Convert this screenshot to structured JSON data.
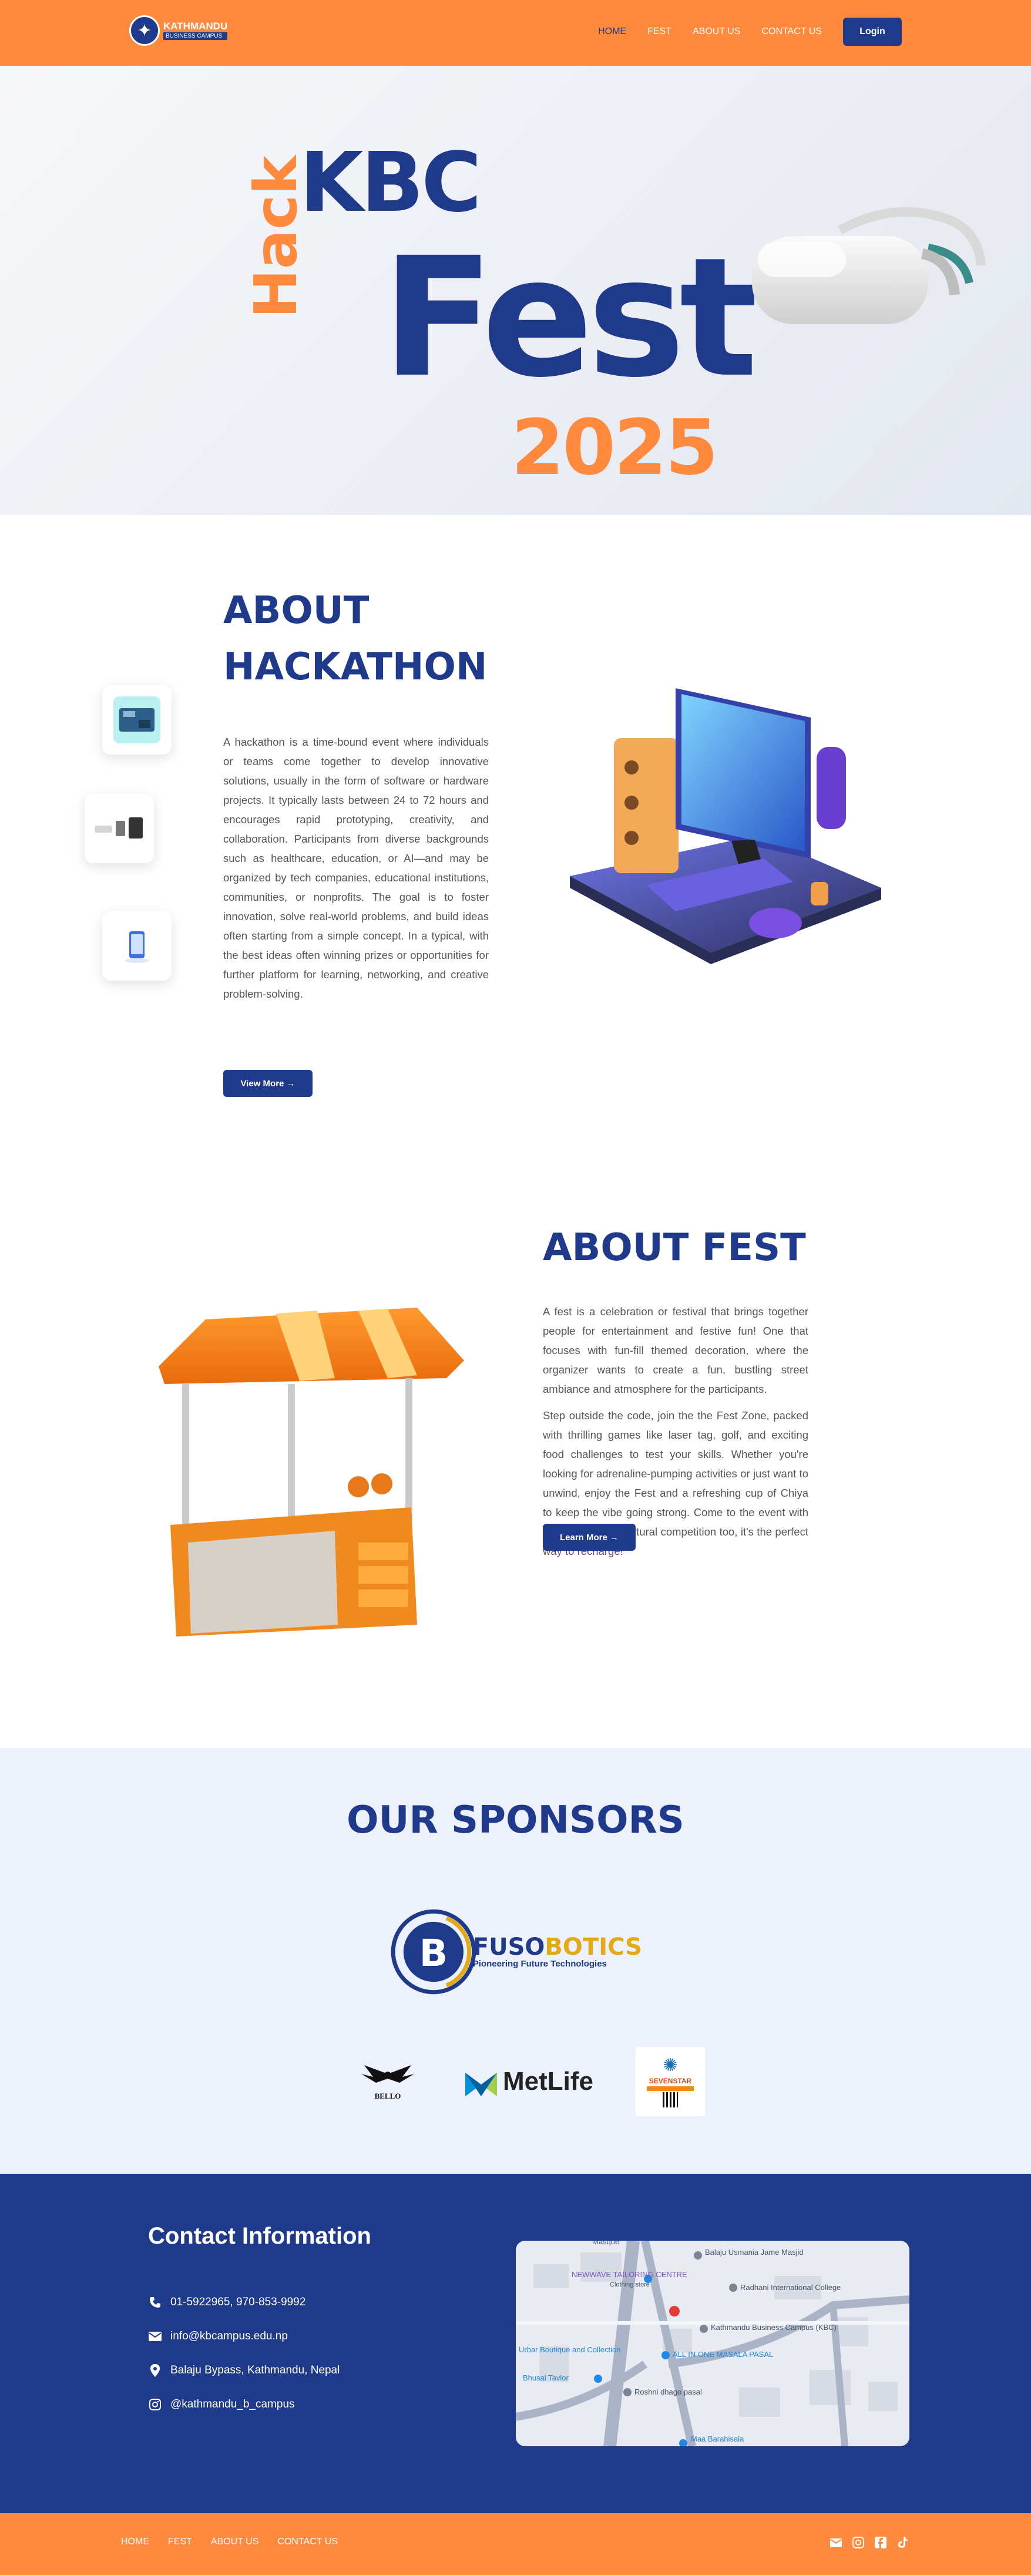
{
  "nav": {
    "logo_line1": "KATHMANDU",
    "logo_line2": "BUSINESS CAMPUS",
    "links": [
      "HOME",
      "FEST",
      "ABOUT US",
      "CONTACT US"
    ],
    "login": "Login"
  },
  "hero": {
    "kbc": "KBC",
    "hack": "Hack",
    "fest": "Fest",
    "year": "2025"
  },
  "about_hackathon": {
    "title": "ABOUT HACKATHON",
    "body": "A hackathon is a time-bound event where individuals or teams come together to develop innovative solutions, usually in the form of software or hardware projects. It typically lasts between 24 to 72 hours and encourages rapid prototyping, creativity, and collaboration. Participants from diverse backgrounds such as healthcare, education, or AI—and may be organized by tech companies, educational institutions, communities, or nonprofits. The goal is to foster innovation, solve real-world problems, and build ideas often starting from a simple concept. In a typical, with the best ideas often winning prizes or opportunities for further platform for learning, networking, and creative problem-solving.",
    "button": "View More →"
  },
  "about_fest": {
    "title": "ABOUT FEST",
    "p1": "A fest is a celebration or festival that brings together people for entertainment and festive fun! One that focuses with fun-fill themed decoration, where the organizer wants to create a fun, bustling street ambiance and atmosphere for the participants.",
    "p2": "Step outside the code, join the the Fest Zone, packed with thrilling games like laser tag, golf, and exciting food challenges to test your skills. Whether you're looking for adrenaline-pumping activities or just want to unwind, enjoy the Fest and a refreshing cup of Chiya to keep the vibe going strong. Come to the event with fun musical and cultural competition too, it's the perfect way to recharge!",
    "button": "Learn More →"
  },
  "sponsors": {
    "title": "OUR SPONSORS",
    "main_name_a": "FUSO",
    "main_name_b": "BOTICS",
    "main_tagline": "Pioneering Future Technologies",
    "bello": "BELLO",
    "metlife": "MetLife",
    "sevenstar": "SEVENSTAR"
  },
  "contact": {
    "title": "Contact Information",
    "phone": "01-5922965, 970-853-9992",
    "email": "info@kbcampus.edu.np",
    "address": "Balaju Bypass, Kathmandu, Nepal",
    "social": "@kathmandu_b_campus",
    "map_labels": [
      "Masque",
      "Balaju Usmania Jame Masjid",
      "NEWWAVE TAILORING CENTRE",
      "Clothing store",
      "Radhani International College",
      "Kathmandu Business Campus (KBC)",
      "Urbar Boutique and Collection",
      "ALL IN ONE MASALA PASAL",
      "Bhusal Tavlor",
      "Roshni dhago pasal",
      "Maa Barahisala"
    ]
  },
  "footer": {
    "links": [
      "HOME",
      "FEST",
      "ABOUT US",
      "CONTACT US"
    ]
  },
  "colors": {
    "orange": "#ff8a3d",
    "navy": "#1f3a8a",
    "light_bg": "#edf1fb"
  }
}
